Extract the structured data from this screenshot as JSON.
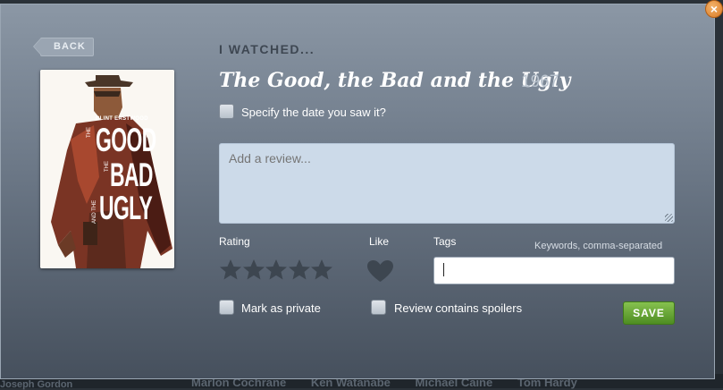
{
  "backdrop": {
    "names": [
      "Marlon Cochrane",
      "Ken Watanabe",
      "Michael Caine",
      "Tom Hardy"
    ],
    "left_text": "Joseph Gordon"
  },
  "modal": {
    "back_label": "BACK",
    "close_label": "×",
    "heading": "I WATCHED...",
    "film_title": "The Good, the Bad and the Ugly",
    "film_year": "1967",
    "specify_date_label": "Specify the date you saw it?",
    "review_placeholder": "Add a review...",
    "rating_label": "Rating",
    "rating_value": 0,
    "rating_max": 5,
    "like_label": "Like",
    "tags_label": "Tags",
    "tags_hint": "Keywords, comma-separated",
    "tags_value": "",
    "private_label": "Mark as private",
    "spoilers_label": "Review contains spoilers",
    "save_label": "SAVE"
  },
  "poster": {
    "actor": "CLINT EASTWOOD",
    "line1": "THE",
    "word1": "GOOD",
    "line2": "THE",
    "word2": "BAD",
    "line3": "AND THE",
    "word3": "UGLY"
  },
  "colors": {
    "modal_top": "#8b97a5",
    "modal_bottom": "#46505d",
    "save_green": "#5e9f2e",
    "close_orange": "#d97a25",
    "poster_red": "#b4271c"
  }
}
